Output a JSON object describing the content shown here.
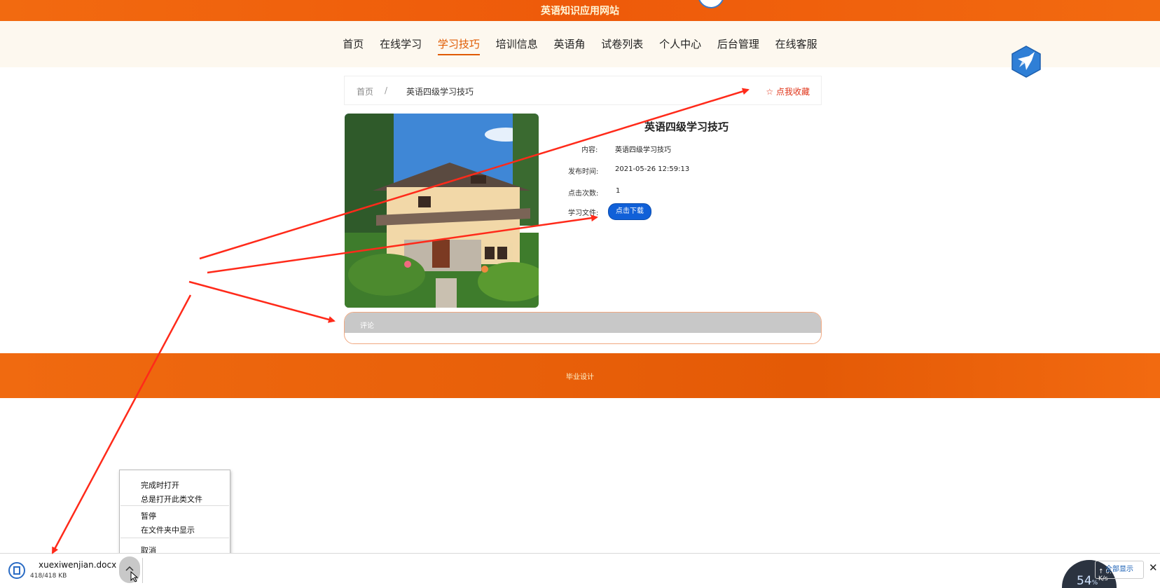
{
  "site": {
    "title": "英语知识应用网站"
  },
  "nav": {
    "items": [
      "首页",
      "在线学习",
      "学习技巧",
      "培训信息",
      "英语角",
      "试卷列表",
      "个人中心",
      "后台管理",
      "在线客服"
    ],
    "active_index": 2
  },
  "breadcrumb": {
    "home": "首页",
    "separator": "/",
    "current": "英语四级学习技巧",
    "favorite": "☆ 点我收藏"
  },
  "detail": {
    "title": "英语四级学习技巧",
    "content_label": "内容:",
    "content_value": "英语四级学习技巧",
    "published_label": "发布时间:",
    "published_value": "2021-05-26 12:59:13",
    "clicks_label": "点击次数:",
    "clicks_value": "1",
    "file_label": "学习文件:",
    "download_button": "点击下载"
  },
  "comment": {
    "header": "评论"
  },
  "footer": {
    "text": "毕业设计"
  },
  "context_menu": {
    "items": [
      "完成时打开",
      "总是打开此类文件",
      "暂停",
      "在文件夹中显示",
      "取消"
    ]
  },
  "download_bar": {
    "filename": "xuexiwenjian.docx",
    "progress": "418/418 KB",
    "show_all": "全部显示",
    "close": "✕",
    "net_percent": "54",
    "net_percent_unit": "%",
    "net_rate": "↑ 0.1 K/s"
  },
  "colors": {
    "brand_orange": "#ee5a0a",
    "button_blue": "#1060d8",
    "annotation_red": "#ff2a1a",
    "favorite_red": "#e0351a"
  }
}
